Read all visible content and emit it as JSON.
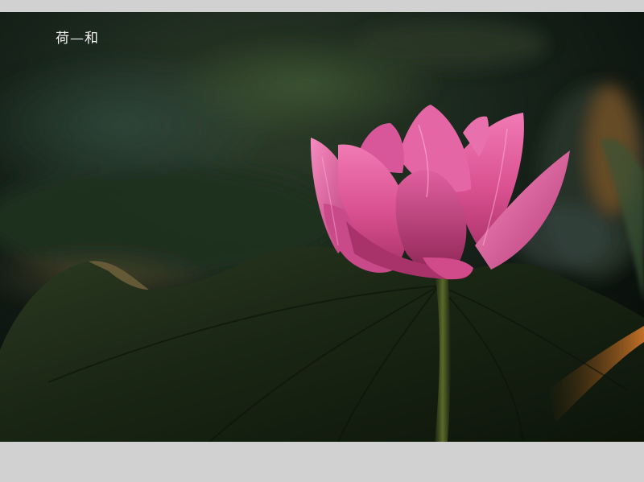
{
  "photo": {
    "caption": "荷—和",
    "subject_icon": "lotus-flower-icon",
    "colors": {
      "frame": "#d1d1d1",
      "background_dark": "#0b1410",
      "petal_pink": "#e35c9c",
      "leaf_green": "#1d2c17",
      "rim_light": "#c86a1e"
    }
  }
}
